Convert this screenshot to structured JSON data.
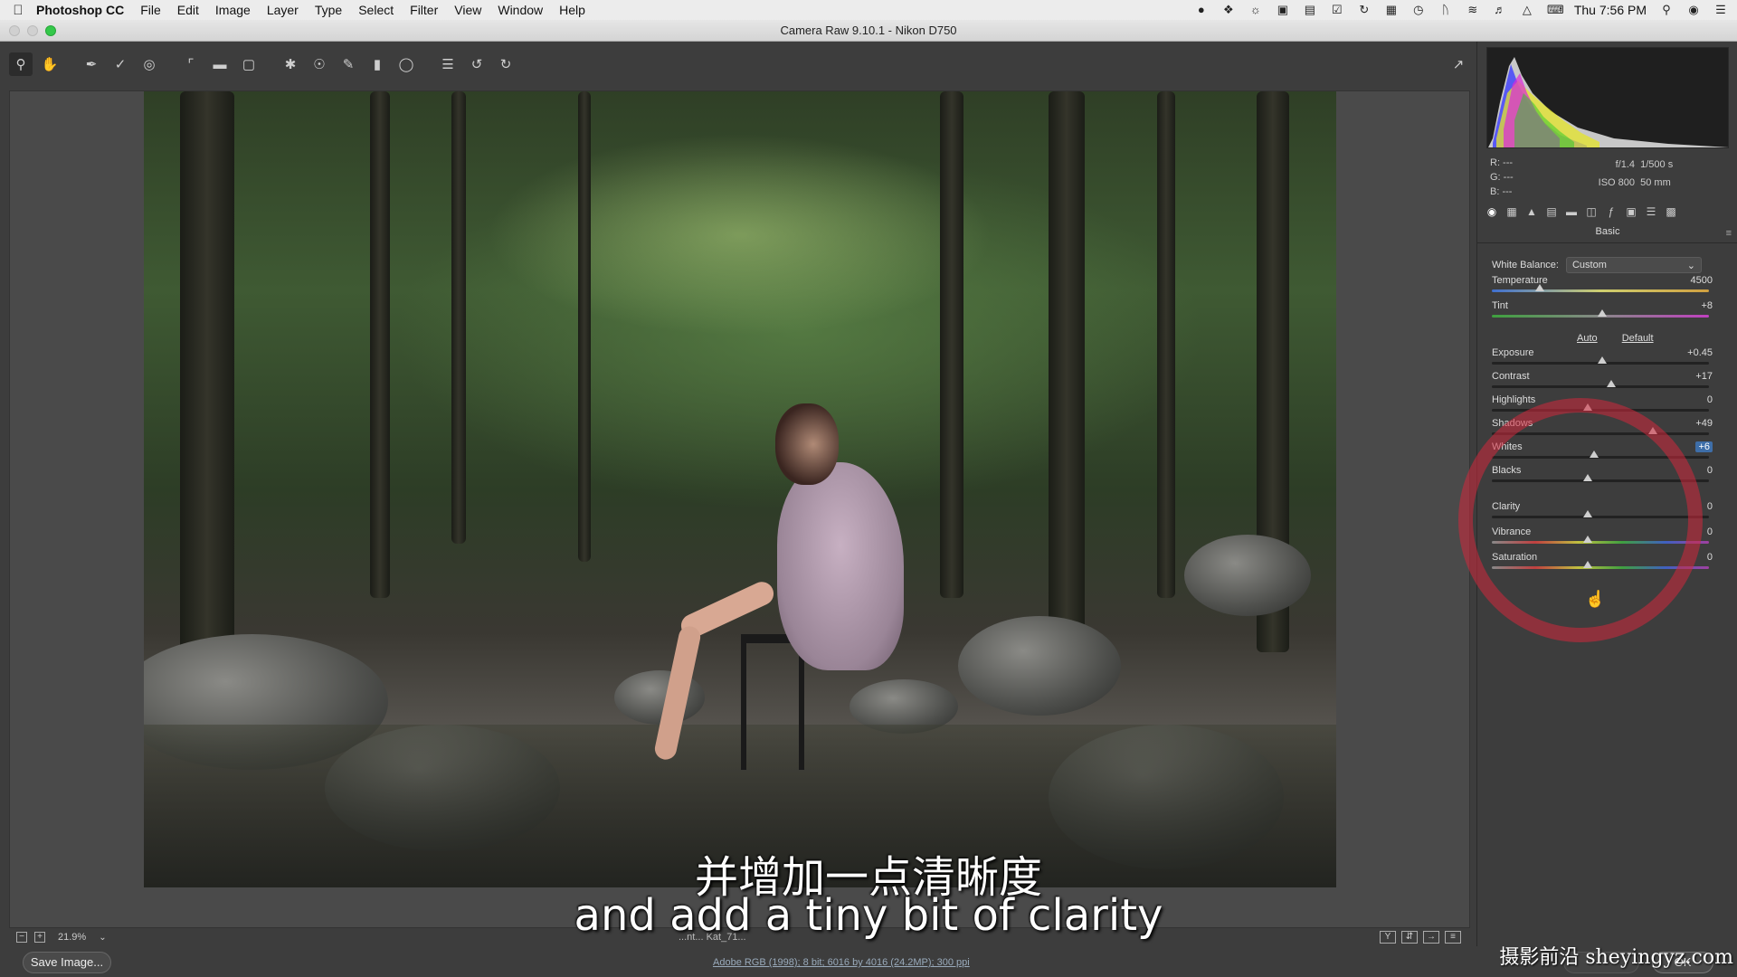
{
  "menubar": {
    "app_name": "Photoshop CC",
    "items": [
      "File",
      "Edit",
      "Image",
      "Layer",
      "Type",
      "Select",
      "Filter",
      "View",
      "Window",
      "Help"
    ],
    "clock": "Thu 7:56 PM"
  },
  "window": {
    "title": "Camera Raw 9.10.1  -  Nikon D750"
  },
  "canvas": {
    "zoom": "21.9%",
    "filename_partial": "...nt... Kat_71...",
    "workflow_link": "Adobe RGB (1998); 8 bit; 6016 by 4016 (24.2MP); 300 ppi"
  },
  "buttons": {
    "save_image": "Save Image...",
    "ok": "OK",
    "cancel": ""
  },
  "histogram": {
    "r": "R:  ---",
    "g": "G:  ---",
    "b": "B:  ---",
    "aperture": "f/1.4",
    "shutter": "1/500 s",
    "iso": "ISO 800",
    "focal": "50 mm"
  },
  "panel": {
    "title": "Basic",
    "white_balance_label": "White Balance:",
    "white_balance_value": "Custom",
    "auto": "Auto",
    "default": "Default"
  },
  "sliders": [
    {
      "name": "Temperature",
      "value": "4500",
      "position": 0.22
    },
    {
      "name": "Tint",
      "value": "+8",
      "position": 0.51
    },
    {
      "name": "Exposure",
      "value": "+0.45",
      "position": 0.51
    },
    {
      "name": "Contrast",
      "value": "+17",
      "position": 0.55
    },
    {
      "name": "Highlights",
      "value": "0",
      "position": 0.44
    },
    {
      "name": "Shadows",
      "value": "+49",
      "position": 0.74
    },
    {
      "name": "Whites",
      "value": "+6",
      "position": 0.47
    },
    {
      "name": "Blacks",
      "value": "0",
      "position": 0.44
    },
    {
      "name": "Clarity",
      "value": "0",
      "position": 0.44
    },
    {
      "name": "Vibrance",
      "value": "0",
      "position": 0.44
    },
    {
      "name": "Saturation",
      "value": "0",
      "position": 0.44
    }
  ],
  "subtitles": {
    "cn": "并增加一点清晰度",
    "en": "and add a tiny bit of clarity"
  },
  "watermark": "摄影前沿 sheyingyz.com"
}
